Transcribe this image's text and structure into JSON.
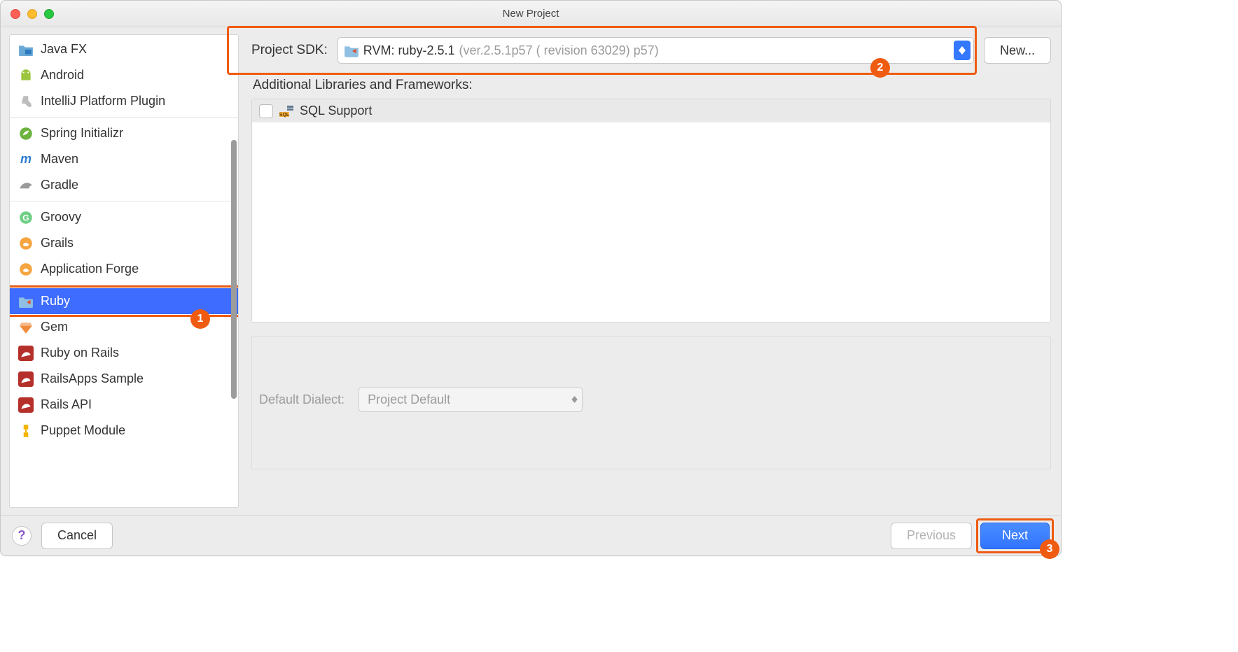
{
  "window": {
    "title": "New Project"
  },
  "sidebar": {
    "groups": [
      [
        {
          "icon": "folder-fx-icon",
          "label": "Java FX"
        },
        {
          "icon": "android-icon",
          "label": "Android"
        },
        {
          "icon": "intellij-plugin-icon",
          "label": "IntelliJ Platform Plugin"
        }
      ],
      [
        {
          "icon": "spring-icon",
          "label": "Spring Initializr"
        },
        {
          "icon": "maven-icon",
          "label": "Maven"
        },
        {
          "icon": "gradle-icon",
          "label": "Gradle"
        }
      ],
      [
        {
          "icon": "groovy-icon",
          "label": "Groovy"
        },
        {
          "icon": "grails-icon",
          "label": "Grails"
        },
        {
          "icon": "grails-icon",
          "label": "Application Forge"
        }
      ],
      [
        {
          "icon": "ruby-icon",
          "label": "Ruby",
          "selected": true
        },
        {
          "icon": "gem-icon",
          "label": "Gem"
        },
        {
          "icon": "rails-icon",
          "label": "Ruby on Rails"
        },
        {
          "icon": "rails-icon",
          "label": "RailsApps Sample"
        },
        {
          "icon": "rails-icon",
          "label": "Rails API"
        },
        {
          "icon": "puppet-icon",
          "label": "Puppet Module"
        }
      ]
    ]
  },
  "main": {
    "sdk_label": "Project SDK:",
    "sdk_name": "RVM: ruby-2.5.1",
    "sdk_version": "(ver.2.5.1p57 ( revision 63029) p57)",
    "new_button": "New...",
    "frameworks_label": "Additional Libraries and Frameworks:",
    "frameworks": [
      {
        "icon": "sql-icon",
        "label": "SQL Support",
        "checked": false
      }
    ],
    "dialect_label": "Default Dialect:",
    "dialect_value": "Project Default"
  },
  "footer": {
    "help": "?",
    "cancel": "Cancel",
    "previous": "Previous",
    "next": "Next"
  },
  "callouts": {
    "one": "1",
    "two": "2",
    "three": "3"
  }
}
